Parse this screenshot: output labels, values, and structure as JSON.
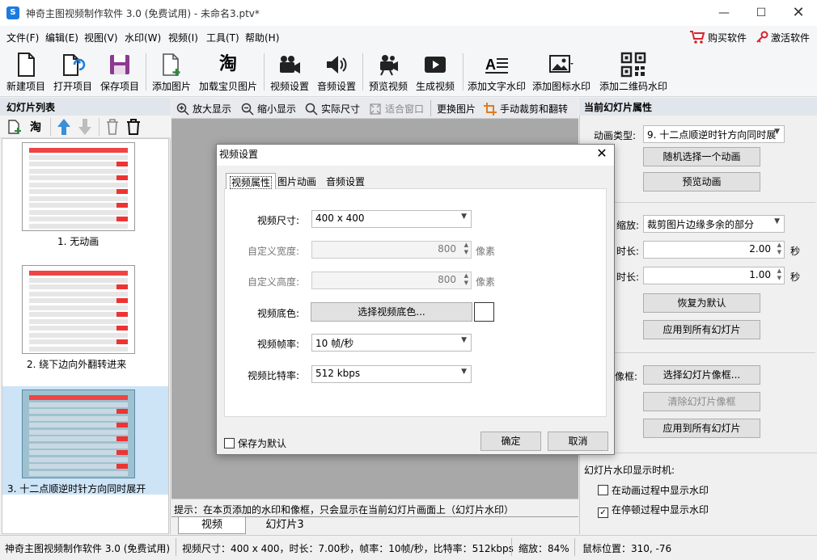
{
  "window": {
    "title": "神奇主图视频制作软件 3.0 (免费试用) - 未命名3.ptv*",
    "logo_glyph": "S"
  },
  "menu": {
    "items": [
      "文件(F)",
      "编辑(E)",
      "视图(V)",
      "水印(W)",
      "视频(I)",
      "工具(T)",
      "帮助(H)"
    ],
    "buy": "购买软件",
    "activate": "激活软件"
  },
  "toolbar": {
    "new_project": "新建项目",
    "open_project": "打开项目",
    "save_project": "保存项目",
    "add_image": "添加图片",
    "load_taobao": "加载宝贝图片",
    "taobao_glyph": "淘",
    "video_settings": "视频设置",
    "audio_settings": "音频设置",
    "preview_video": "预览视频",
    "generate_video": "生成视频",
    "add_text_watermark": "添加文字水印",
    "add_icon_watermark": "添加图标水印",
    "add_qr_watermark": "添加二维码水印"
  },
  "left_panel": {
    "title": "幻灯片列表",
    "taobao_glyph": "淘",
    "slides": [
      {
        "label": "1. 无动画"
      },
      {
        "label": "2. 绕下边向外翻转进来"
      },
      {
        "label": "3. 十二点顺逆时针方向同时展开"
      }
    ]
  },
  "center": {
    "zoom_in": "放大显示",
    "zoom_out": "缩小显示",
    "actual_size": "实际尺寸",
    "fit_window": "适合窗口",
    "replace_image": "更换图片",
    "manual_crop": "手动裁剪和翻转",
    "hint": "提示：在本页添加的水印和像框，只会显示在当前幻灯片画面上（幻灯片水印）",
    "tabs": [
      "视频",
      "幻灯片3"
    ]
  },
  "right_panel": {
    "title": "当前幻灯片属性",
    "anim_type_label": "动画类型:",
    "anim_type_value": "9. 十二点顺逆时针方向同时展",
    "random_anim": "随机选择一个动画",
    "preview_anim": "预览动画",
    "zoom_label": "缩放:",
    "zoom_value": "裁剪图片边缘多余的部分",
    "duration1_label": "时长:",
    "duration1_value": "2.00",
    "duration2_label": "时长:",
    "duration2_value": "1.00",
    "seconds": "秒",
    "restore_default": "恢复为默认",
    "apply_all_1": "应用到所有幻灯片",
    "frame_label": "像框:",
    "choose_frame": "选择幻灯片像框...",
    "clear_frame": "清除幻灯片像框",
    "apply_all_2": "应用到所有幻灯片",
    "watermark_timing": "幻灯片水印显示时机:",
    "show_in_anim": "在动画过程中显示水印",
    "show_in_anim_checked": false,
    "show_in_pause": "在停顿过程中显示水印",
    "show_in_pause_checked": true
  },
  "dialog": {
    "title": "视频设置",
    "tabs": [
      "视频属性",
      "图片动画",
      "音频设置"
    ],
    "size_label": "视频尺寸:",
    "size_value": "400 x 400",
    "width_label": "自定义宽度:",
    "width_value": "800",
    "height_label": "自定义高度:",
    "height_value": "800",
    "pixel_unit": "像素",
    "bg_label": "视频底色:",
    "bg_button": "选择视频底色...",
    "bg_color": "#ffffff",
    "fps_label": "视频帧率:",
    "fps_value": "10 帧/秒",
    "bitrate_label": "视频比特率:",
    "bitrate_value": "512 kbps",
    "save_default": "保存为默认",
    "ok": "确定",
    "cancel": "取消"
  },
  "status": {
    "app": "神奇主图视频制作软件 3.0 (免费试用)",
    "info": "视频尺寸：400 x 400，时长：7.00秒，帧率：10帧/秒，比特率：512kbps",
    "zoom": "缩放：84%",
    "mouse": "鼠标位置：310, -76"
  },
  "colors": {
    "accent_blue": "#1d7be0",
    "buy_red": "#d9232d",
    "canvas_gray": "#a8a8a8",
    "save_purple": "#8b3a8f"
  }
}
